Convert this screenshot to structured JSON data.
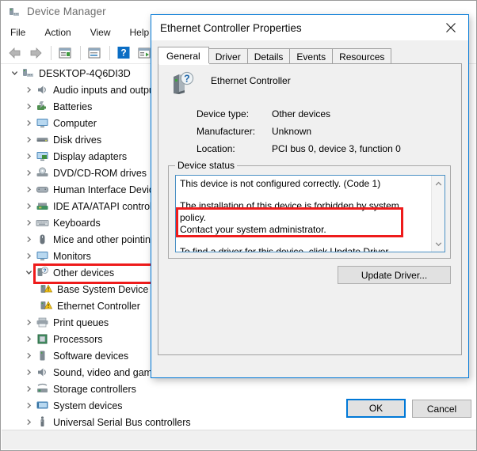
{
  "main_window": {
    "title": "Device Manager",
    "title_icon": "device-manager-icon",
    "menu": [
      {
        "label": "File"
      },
      {
        "label": "Action"
      },
      {
        "label": "View"
      },
      {
        "label": "Help"
      }
    ],
    "toolbar": [
      {
        "name": "back-icon"
      },
      {
        "name": "forward-icon"
      },
      {
        "name": "separator"
      },
      {
        "name": "properties-icon"
      },
      {
        "name": "separator"
      },
      {
        "name": "show-hidden-devices-icon"
      },
      {
        "name": "separator"
      },
      {
        "name": "help-icon"
      },
      {
        "name": "update-driver-icon"
      },
      {
        "name": "separator"
      },
      {
        "name": "scan-hardware-changes-icon"
      }
    ],
    "tree": {
      "root": {
        "label": "DESKTOP-4Q6DI3D",
        "icon": "computer-icon",
        "expanded": true
      },
      "items": [
        {
          "label": "Audio inputs and outputs",
          "icon": "speaker-icon",
          "indent": 1,
          "expanded": false
        },
        {
          "label": "Batteries",
          "icon": "battery-icon",
          "indent": 1,
          "expanded": false
        },
        {
          "label": "Computer",
          "icon": "monitor-icon",
          "indent": 1,
          "expanded": false
        },
        {
          "label": "Disk drives",
          "icon": "disk-icon",
          "indent": 1,
          "expanded": false
        },
        {
          "label": "Display adapters",
          "icon": "display-adapter-icon",
          "indent": 1,
          "expanded": false
        },
        {
          "label": "DVD/CD-ROM drives",
          "icon": "optical-drive-icon",
          "indent": 1,
          "expanded": false
        },
        {
          "label": "Human Interface Devices",
          "icon": "hid-icon",
          "indent": 1,
          "expanded": false
        },
        {
          "label": "IDE ATA/ATAPI controllers",
          "icon": "ide-controller-icon",
          "indent": 1,
          "expanded": false
        },
        {
          "label": "Keyboards",
          "icon": "keyboard-icon",
          "indent": 1,
          "expanded": false
        },
        {
          "label": "Mice and other pointing devices",
          "icon": "mouse-icon",
          "indent": 1,
          "expanded": false
        },
        {
          "label": "Monitors",
          "icon": "monitor-icon",
          "indent": 1,
          "expanded": false
        },
        {
          "label": "Other devices",
          "icon": "unknown-device-icon",
          "indent": 1,
          "expanded": true
        },
        {
          "label": "Base System Device",
          "icon": "warning-device-icon",
          "indent": 2,
          "warning": true
        },
        {
          "label": "Ethernet Controller",
          "icon": "warning-device-icon",
          "indent": 2,
          "warning": true,
          "highlighted": true
        },
        {
          "label": "Print queues",
          "icon": "printer-icon",
          "indent": 1,
          "expanded": false
        },
        {
          "label": "Processors",
          "icon": "processor-icon",
          "indent": 1,
          "expanded": false
        },
        {
          "label": "Software devices",
          "icon": "software-device-icon",
          "indent": 1,
          "expanded": false
        },
        {
          "label": "Sound, video and game controllers",
          "icon": "sound-icon",
          "indent": 1,
          "expanded": false
        },
        {
          "label": "Storage controllers",
          "icon": "storage-controller-icon",
          "indent": 1,
          "expanded": false
        },
        {
          "label": "System devices",
          "icon": "system-device-icon",
          "indent": 1,
          "expanded": false
        },
        {
          "label": "Universal Serial Bus controllers",
          "icon": "usb-icon",
          "indent": 1,
          "expanded": false
        }
      ]
    }
  },
  "dialog": {
    "title": "Ethernet Controller Properties",
    "close_icon": "close-icon",
    "tabs": [
      {
        "label": "General",
        "active": true
      },
      {
        "label": "Driver",
        "active": false
      },
      {
        "label": "Details",
        "active": false
      },
      {
        "label": "Events",
        "active": false
      },
      {
        "label": "Resources",
        "active": false
      }
    ],
    "device": {
      "icon": "unknown-device-icon",
      "name": "Ethernet Controller",
      "properties": [
        {
          "label": "Device type:",
          "value": "Other devices"
        },
        {
          "label": "Manufacturer:",
          "value": "Unknown"
        },
        {
          "label": "Location:",
          "value": "PCI bus 0, device 3, function 0"
        }
      ]
    },
    "device_status": {
      "group_label": "Device status",
      "paragraph_1": "This device is not configured correctly. (Code 1)",
      "paragraph_2_line_1": "The installation of this device is forbidden by system policy.",
      "paragraph_2_line_2": "Contact your system administrator.",
      "paragraph_3": "To find a driver for this device, click Update Driver.",
      "scroll_up_icon": "chevron-up-icon",
      "scroll_down_icon": "chevron-down-icon"
    },
    "buttons": {
      "update_driver": "Update Driver...",
      "ok": "OK",
      "cancel": "Cancel"
    }
  },
  "annotations": {
    "highlight_color": "#ee1b1b",
    "accent_color": "#0078d7"
  }
}
